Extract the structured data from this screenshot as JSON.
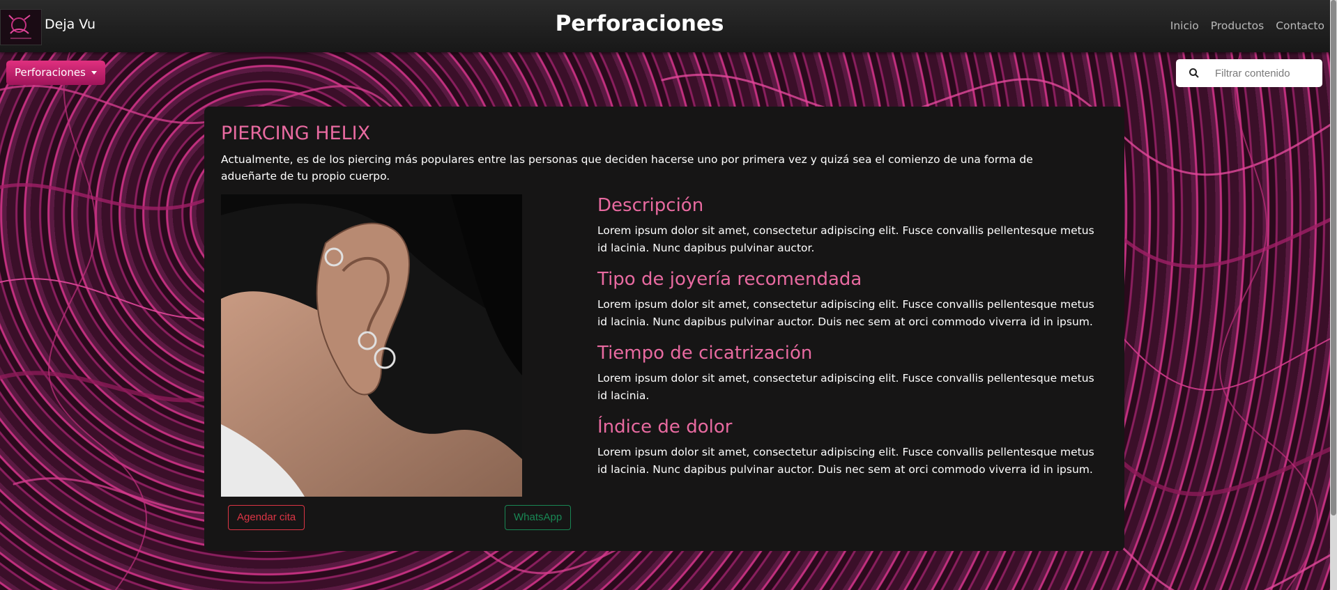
{
  "navbar": {
    "brand": "Deja Vu",
    "title": "Perforaciones",
    "links": [
      "Inicio",
      "Productos",
      "Contacto"
    ]
  },
  "toolbar": {
    "dropdown_label": "Perforaciones",
    "search_placeholder": "Filtrar contenido"
  },
  "card": {
    "title": "PIERCING HELIX",
    "intro": "Actualmente, es de los piercing más populares entre las personas que deciden hacerse uno por primera vez y quizá sea el comienzo de una forma de adueñarte de tu propio cuerpo.",
    "buttons": {
      "agendar": "Agendar cita",
      "whatsapp": "WhatsApp"
    },
    "sections": [
      {
        "heading": "Descripción",
        "text": "Lorem ipsum dolor sit amet, consectetur adipiscing elit. Fusce convallis pellentesque metus id lacinia. Nunc dapibus pulvinar auctor."
      },
      {
        "heading": "Tipo de joyería recomendada",
        "text": "Lorem ipsum dolor sit amet, consectetur adipiscing elit. Fusce convallis pellentesque metus id lacinia. Nunc dapibus pulvinar auctor. Duis nec sem at orci commodo viverra id in ipsum."
      },
      {
        "heading": "Tiempo de cicatrización",
        "text": "Lorem ipsum dolor sit amet, consectetur adipiscing elit. Fusce convallis pellentesque metus id lacinia."
      },
      {
        "heading": "Índice de dolor",
        "text": "Lorem ipsum dolor sit amet, consectetur adipiscing elit. Fusce convallis pellentesque metus id lacinia. Nunc dapibus pulvinar auctor. Duis nec sem at orci commodo viverra id in ipsum."
      }
    ]
  },
  "colors": {
    "accent": "#e86aa0",
    "danger": "#dc3545",
    "success": "#198754",
    "card_bg": "#161515"
  }
}
